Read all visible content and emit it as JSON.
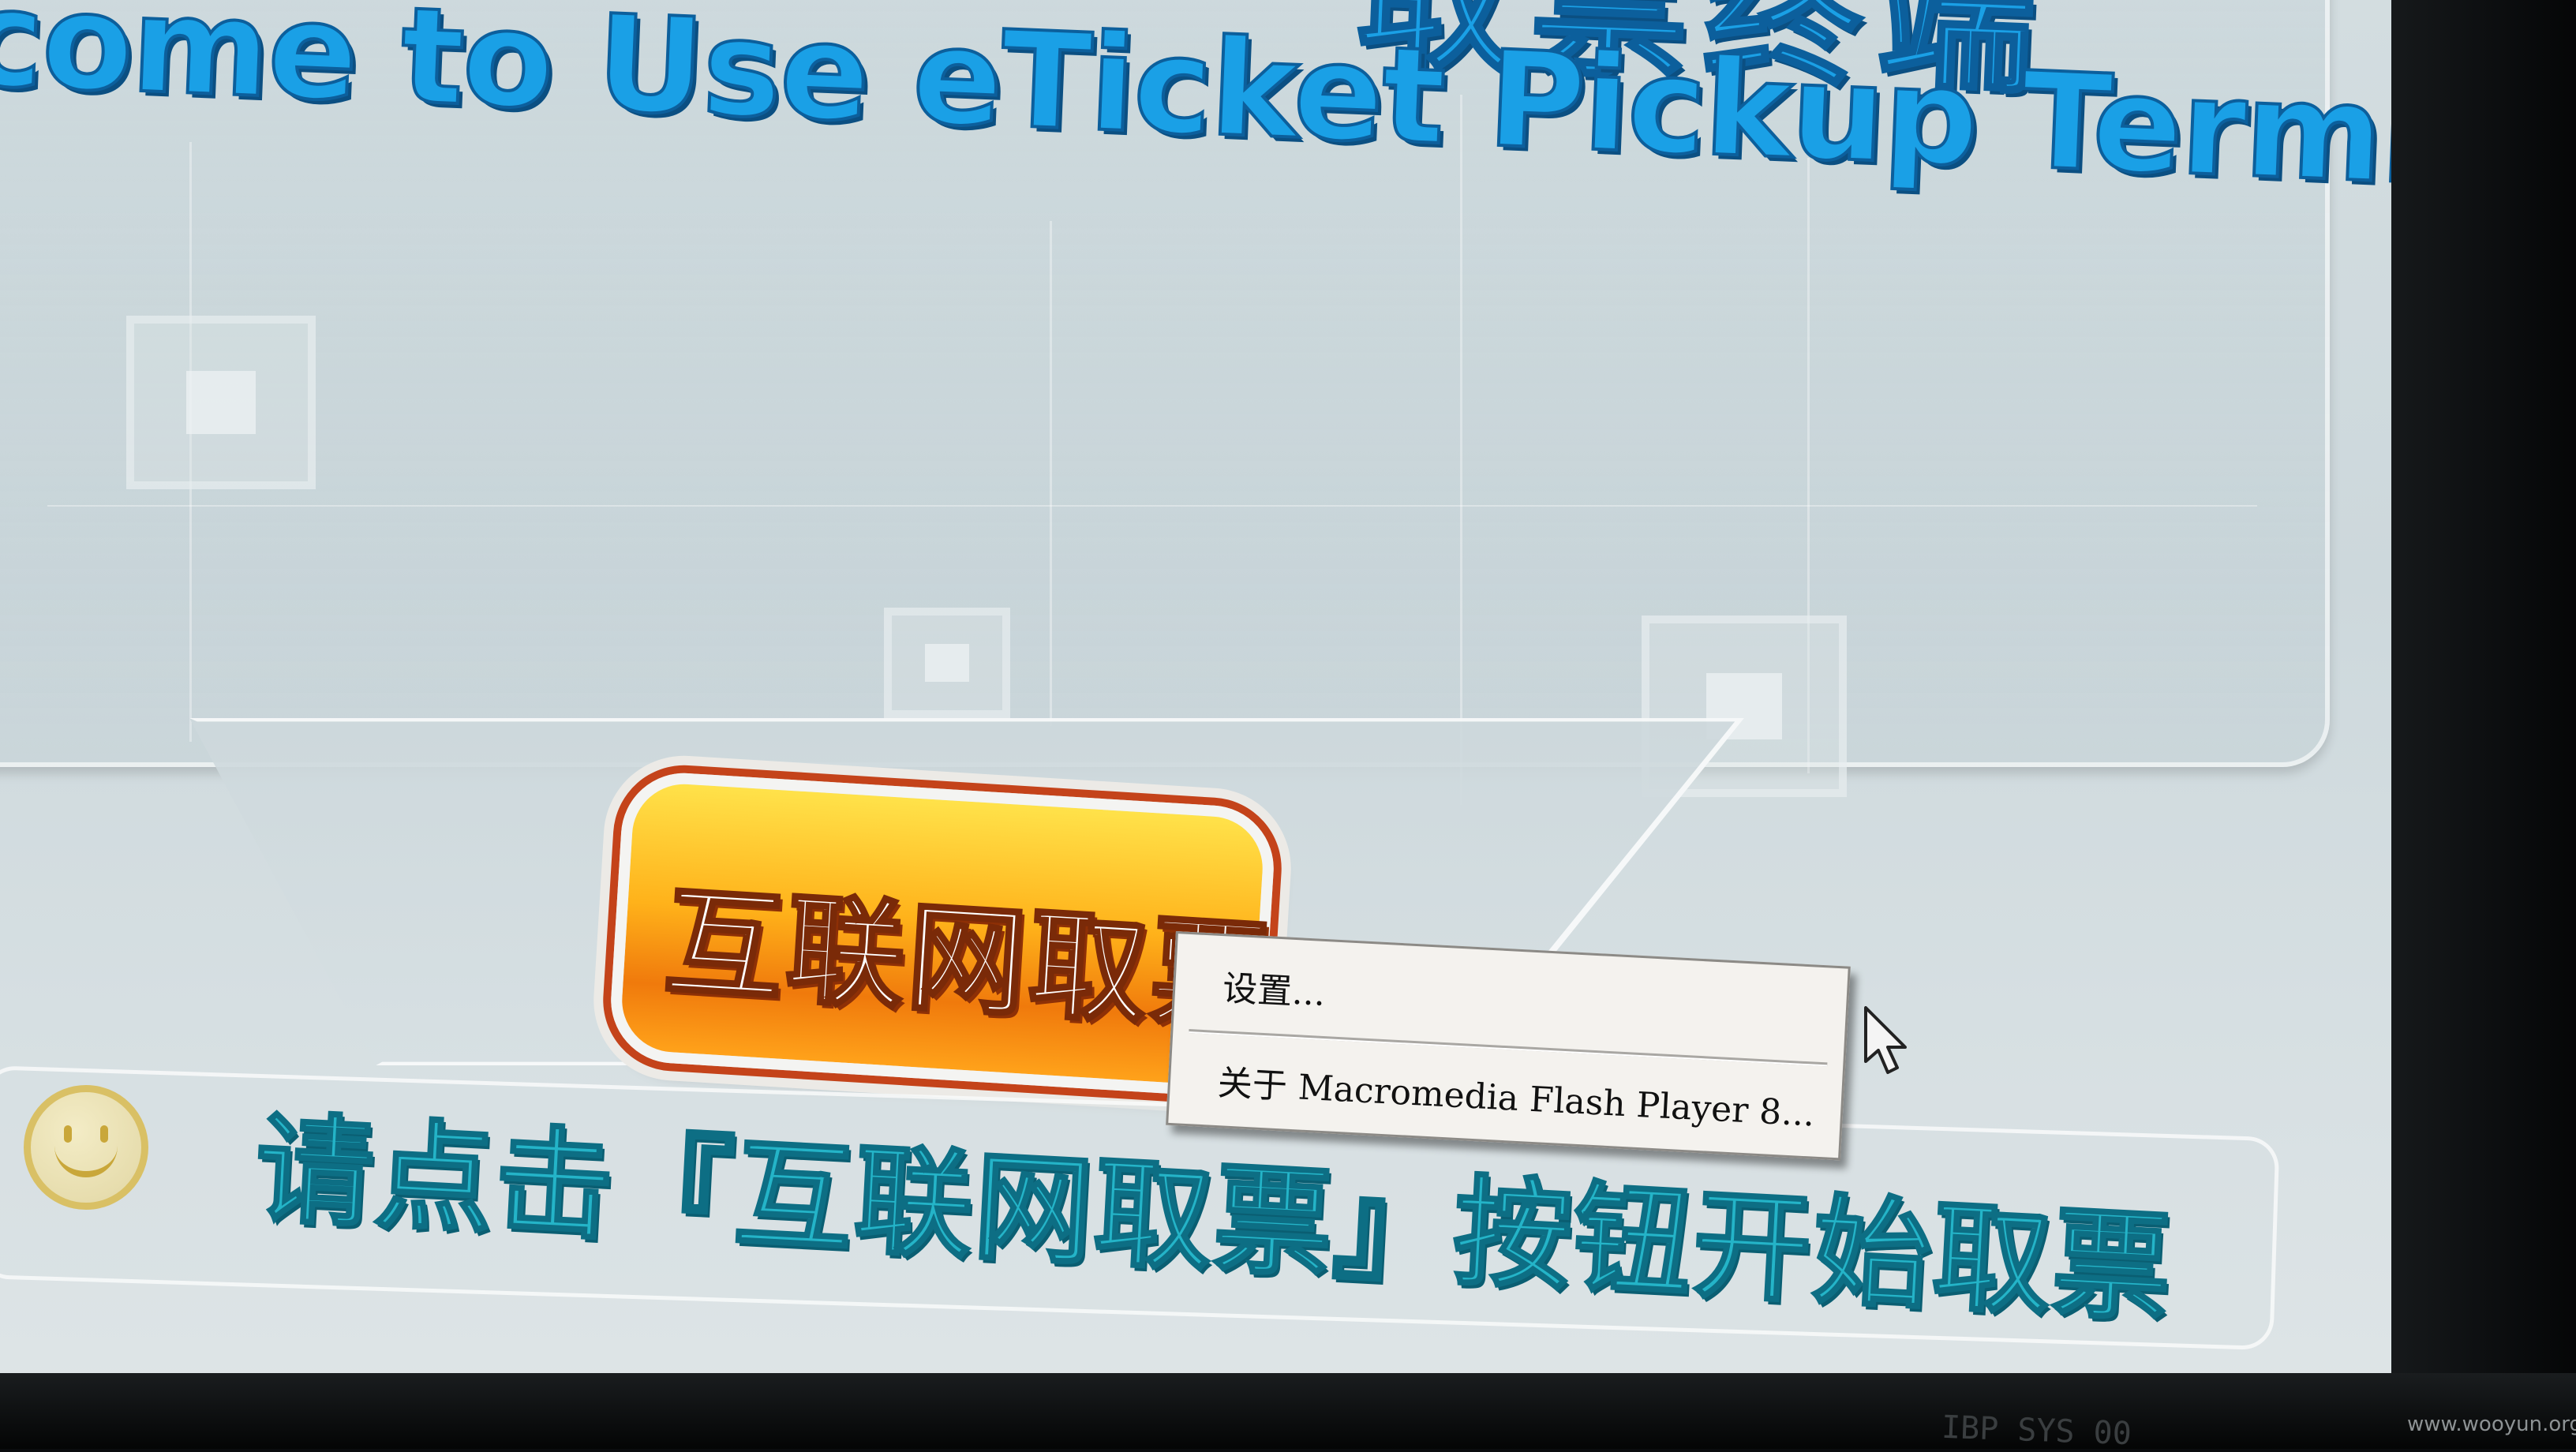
{
  "title": {
    "english": "come to Use eTicket Pickup Terminal",
    "chinese_partial": "取票终端"
  },
  "main_button": {
    "label": "互联网取票"
  },
  "context_menu": {
    "items": [
      {
        "label": "设置..."
      },
      {
        "label": "关于 Macromedia Flash Player 8..."
      }
    ]
  },
  "instruction": {
    "text": "请点击『互联网取票』按钮开始取票"
  },
  "footer": {
    "partial_code": "IBP SYS 00"
  },
  "watermark": {
    "text": "www.wooyun.org"
  },
  "icons": {
    "cursor": "arrow-cursor-icon",
    "smiley": "smiley-icon"
  },
  "colors": {
    "title_blue": "#1aa0e6",
    "instruction_teal": "#24b4c8",
    "button_orange": "#ffb21a",
    "background": "#d3dde0"
  }
}
